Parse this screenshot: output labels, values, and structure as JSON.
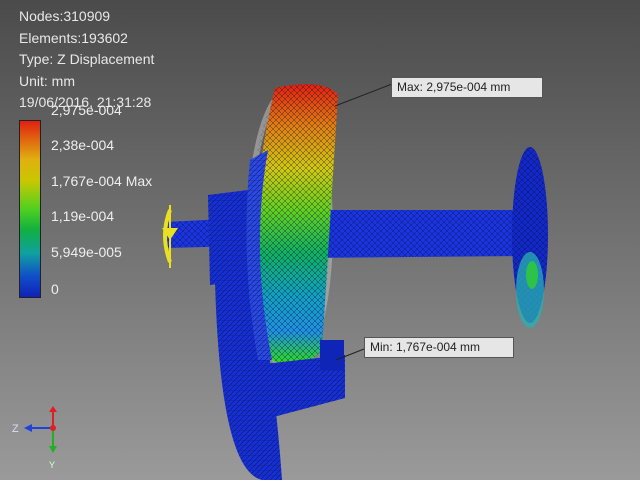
{
  "info": {
    "nodes": "Nodes:310909",
    "elements": "Elements:193602",
    "type": "Type: Z Displacement",
    "unit": "Unit: mm",
    "timestamp": "19/06/2016, 21:31:28"
  },
  "legend": {
    "labels": [
      "2,975e-004",
      "2,38e-004",
      "1,767e-004 Max",
      "1,19e-004",
      "5,949e-005",
      "0"
    ],
    "colors": [
      "#e02010",
      "#e09a10",
      "#c8c800",
      "#30c020",
      "#10a0a0",
      "#1030c0"
    ]
  },
  "callouts": {
    "max": "Max: 2,975e-004 mm",
    "min": "Min: 1,767e-004 mm"
  },
  "triad": {
    "z_label": "Z",
    "y_label": "Y"
  },
  "colors": {
    "mesh_blue": "#1530d8",
    "accent_yellow": "#e8e020"
  }
}
